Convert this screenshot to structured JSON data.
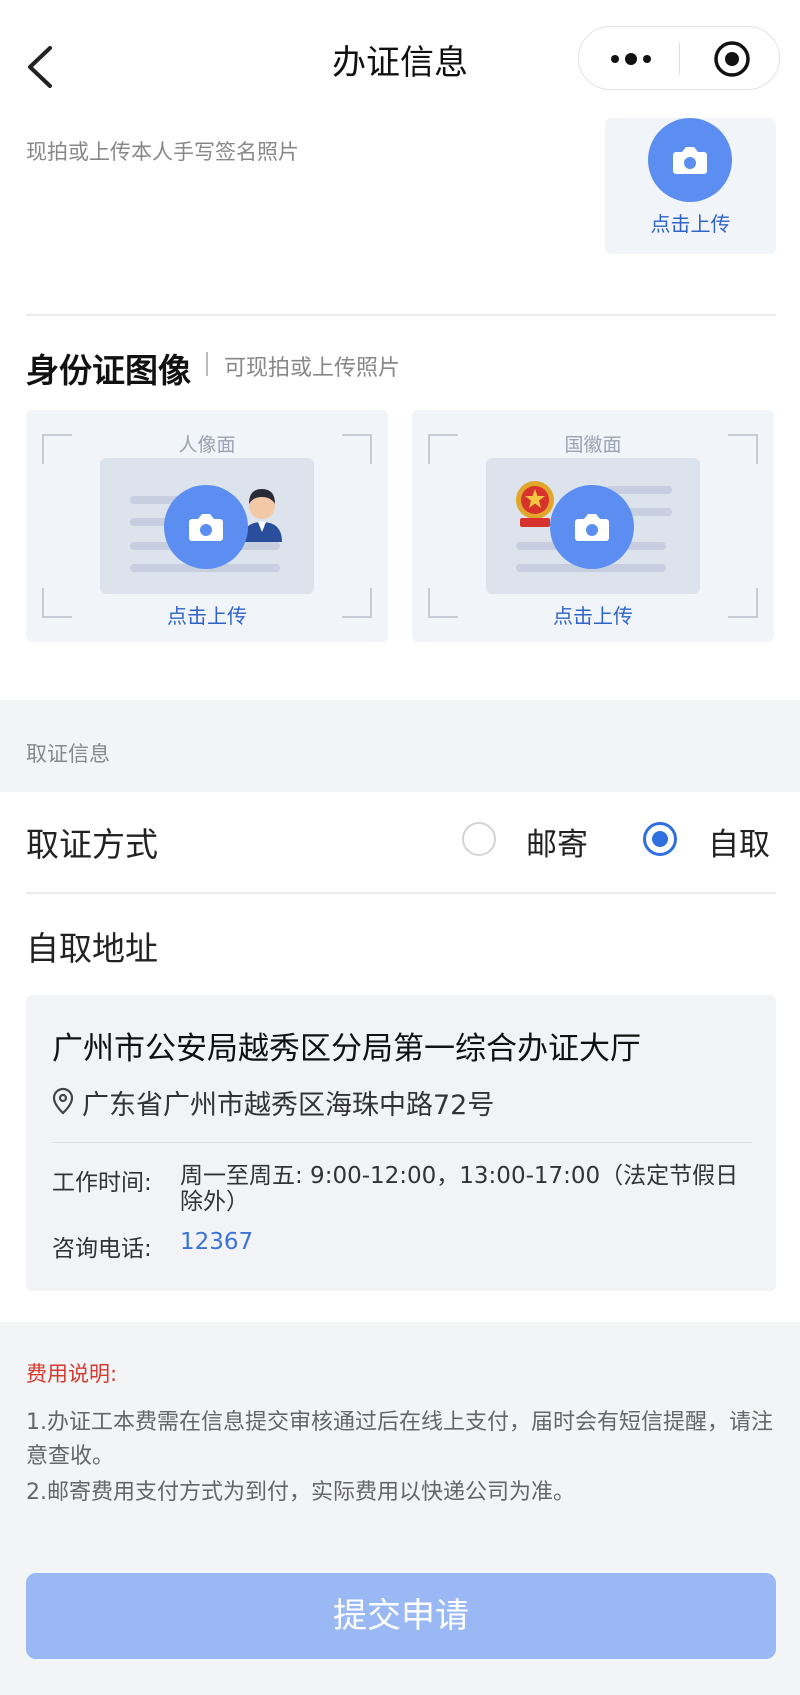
{
  "header": {
    "title": "办证信息",
    "back_icon": "chevron-left-icon",
    "more_icon": "more-dots-icon",
    "close_icon": "target-circle-icon"
  },
  "signature": {
    "hint": "现拍或上传本人手写签名照片",
    "upload_label": "点击上传"
  },
  "id_images": {
    "title": "身份证图像",
    "subtitle": "可现拍或上传照片",
    "cards": [
      {
        "face": "人像面",
        "upload_label": "点击上传"
      },
      {
        "face": "国徽面",
        "upload_label": "点击上传"
      }
    ]
  },
  "pickup": {
    "section_label": "取证信息",
    "method_label": "取证方式",
    "options": [
      {
        "label": "邮寄",
        "selected": false
      },
      {
        "label": "自取",
        "selected": true
      }
    ],
    "address_label": "自取地址",
    "location": {
      "name": "广州市公安局越秀区分局第一综合办证大厅",
      "address": "广东省广州市越秀区海珠中路72号",
      "hours_label": "工作时间:",
      "hours": "周一至周五: 9:00-12:00，13:00-17:00（法定节假日除外）",
      "phone_label": "咨询电话:",
      "phone": "12367"
    }
  },
  "fees": {
    "title": "费用说明:",
    "notes": [
      "1.办证工本费需在信息提交审核通过后在线上支付，届时会有短信提醒，请注意查收。",
      "2.邮寄费用支付方式为到付，实际费用以快递公司为准。"
    ]
  },
  "submit_label": "提交申请",
  "colors": {
    "accent": "#2f6fe0",
    "camera_circle": "#5b8ef0",
    "submit_disabled": "#9ab8f4",
    "fee_title": "#d43a2f",
    "phone_link": "#3b74d8"
  }
}
